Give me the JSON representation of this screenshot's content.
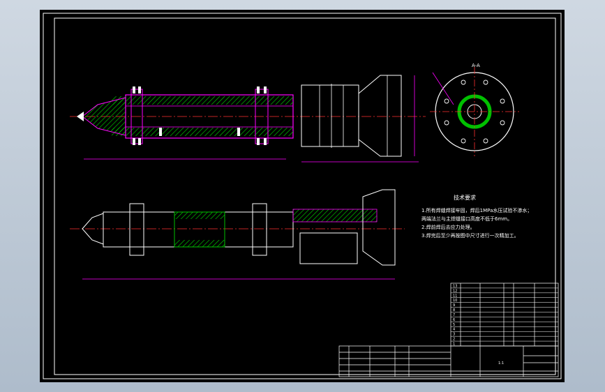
{
  "colors": {
    "paper": "#000000",
    "frame": "#ffffff",
    "outline": "#ff00ff",
    "hatch": "#00c000",
    "centerline": "#ff3030",
    "detail": "#ffffff",
    "note_text": "#ffffff",
    "table_line": "#ffffff"
  },
  "section_label": "A-A",
  "notes": {
    "title": "技术要求",
    "lines": [
      "1.所有焊缝焊接牢固，焊后1MPa水压试验不渗水；",
      "  两端法兰与主焊缝接口高度不低于6mm。",
      "2.焊前焊后去应力处理。",
      "3.焊完后至少再按图中尺寸进行一次精加工。"
    ]
  },
  "parts_rows": [
    "13",
    "12",
    "11",
    "10",
    "9",
    "8",
    "7",
    "6",
    "5",
    "4",
    "3",
    "2",
    "1"
  ],
  "title_block": {
    "drawing_title": "1:1"
  },
  "icons": {
    "balloon": "circle-balloon-icon",
    "section_arrow": "arrow-icon"
  }
}
